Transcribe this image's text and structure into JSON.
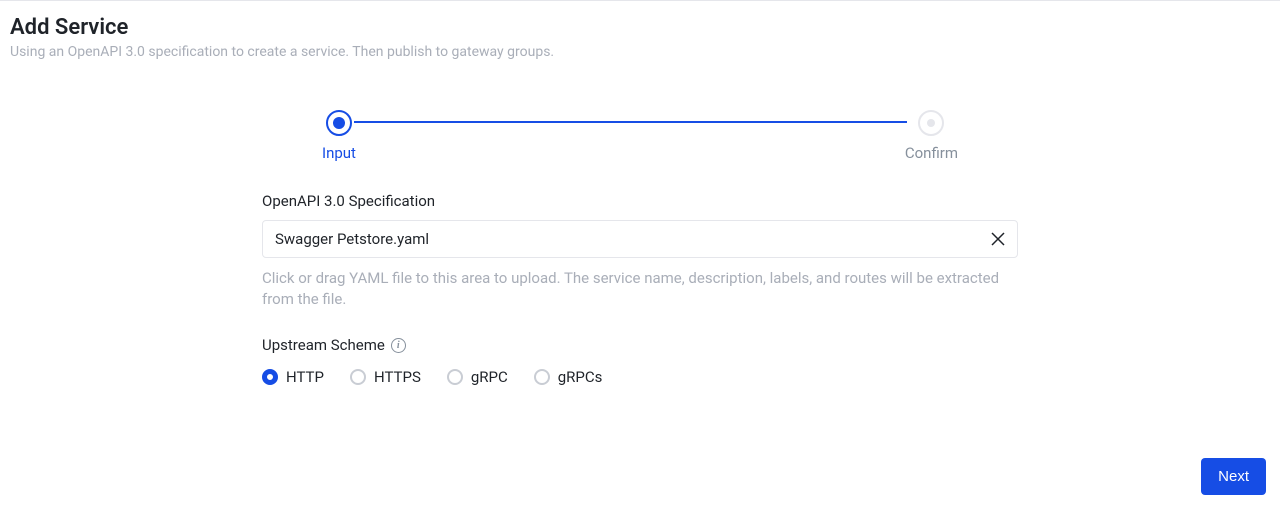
{
  "header": {
    "title": "Add Service",
    "subtitle": "Using an OpenAPI 3.0 specification to create a service. Then publish to gateway groups."
  },
  "stepper": {
    "steps": [
      {
        "label": "Input",
        "active": true
      },
      {
        "label": "Confirm",
        "active": false
      }
    ]
  },
  "form": {
    "spec": {
      "label": "OpenAPI 3.0 Specification",
      "filename": "Swagger Petstore.yaml",
      "help": "Click or drag YAML file to this area to upload. The service name, description, labels, and routes will be extracted from the file."
    },
    "upstream_scheme": {
      "label": "Upstream Scheme",
      "options": [
        {
          "label": "HTTP",
          "selected": true
        },
        {
          "label": "HTTPS",
          "selected": false
        },
        {
          "label": "gRPC",
          "selected": false
        },
        {
          "label": "gRPCs",
          "selected": false
        }
      ]
    }
  },
  "footer": {
    "next_label": "Next"
  }
}
